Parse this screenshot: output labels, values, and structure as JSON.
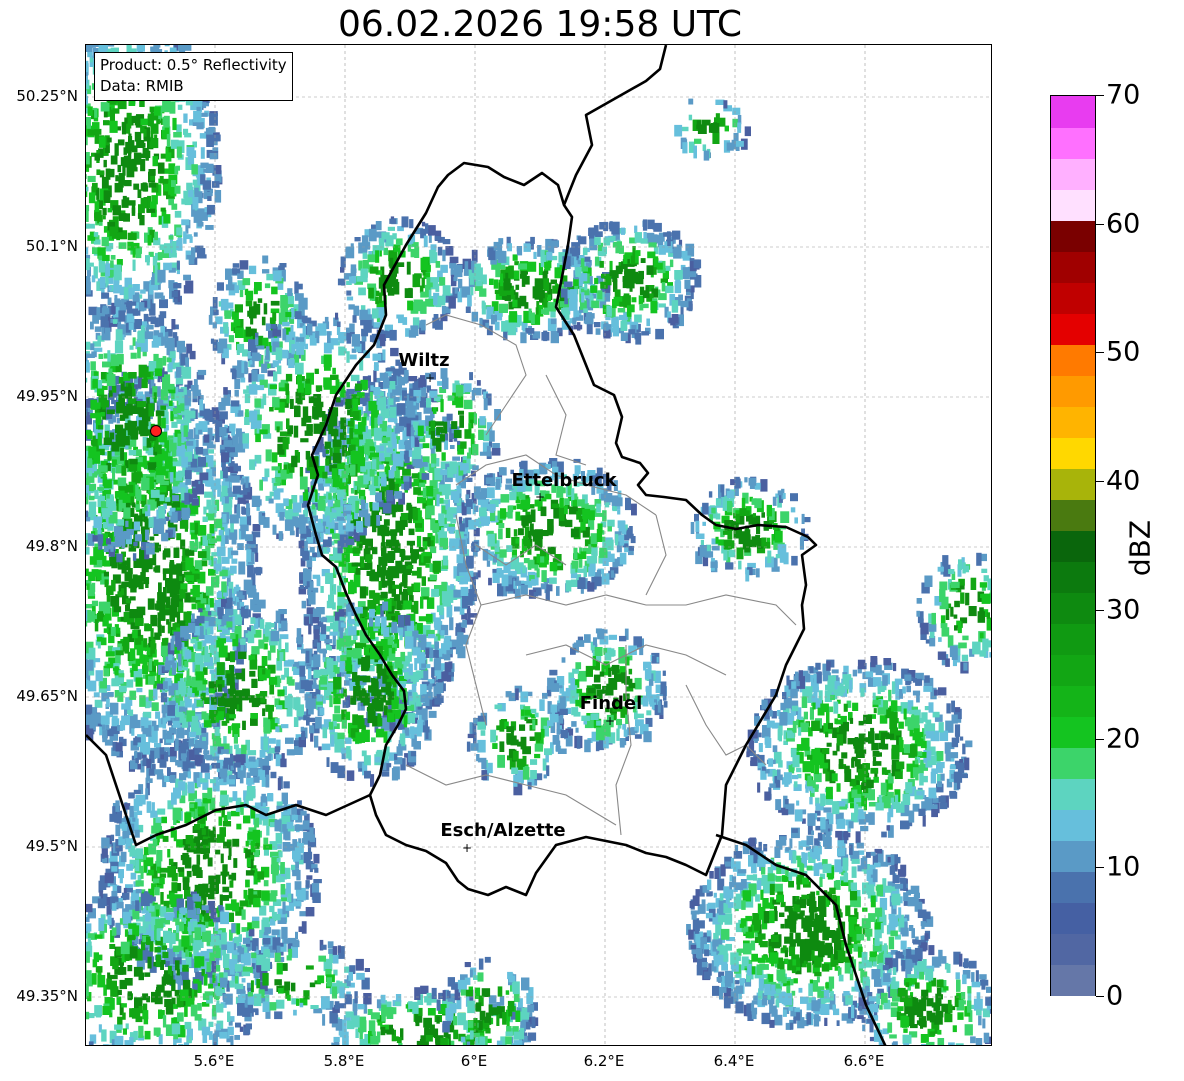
{
  "title": "06.02.2026 19:58 UTC",
  "info": {
    "product": "Product: 0.5° Reflectivity",
    "data": "Data: RMIB"
  },
  "axes": {
    "lat_ticks": [
      "50.25°N",
      "50.1°N",
      "49.95°N",
      "49.8°N",
      "49.65°N",
      "49.5°N",
      "49.35°N"
    ],
    "lon_ticks": [
      "5.6°E",
      "5.8°E",
      "6°E",
      "6.2°E",
      "6.4°E",
      "6.6°E"
    ]
  },
  "cities": [
    "Wiltz",
    "Ettelbruck",
    "Findel",
    "Esch/Alzette"
  ],
  "colorbar": {
    "label": "dBZ",
    "ticks": [
      "0",
      "10",
      "20",
      "30",
      "40",
      "50",
      "60",
      "70"
    ],
    "colors": [
      "#6577a8",
      "#5167a3",
      "#4560a3",
      "#4a72ad",
      "#5a9ac6",
      "#66bfdc",
      "#5dd4c0",
      "#3cd46a",
      "#14c420",
      "#14b418",
      "#12a614",
      "#109a12",
      "#0e8a10",
      "#0c7a0e",
      "#0a660c",
      "#4a7a10",
      "#a8b40a",
      "#ffd800",
      "#ffb400",
      "#ff9a00",
      "#ff7a00",
      "#e40000",
      "#c00000",
      "#a00000",
      "#7a0000",
      "#ffe0ff",
      "#ffb0ff",
      "#ff70ff",
      "#e83cf0"
    ]
  },
  "radar_site": "red-circle"
}
